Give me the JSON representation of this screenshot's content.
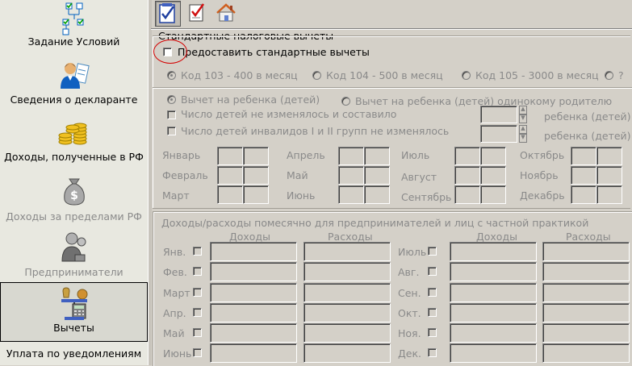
{
  "sidebar": {
    "items": [
      {
        "label": "Задание Условий",
        "icon": "conditions-icon",
        "state": "normal"
      },
      {
        "label": "Сведения о декларанте",
        "icon": "declarant-icon",
        "state": "normal"
      },
      {
        "label": "Доходы, полученные в РФ",
        "icon": "coins-icon",
        "state": "normal"
      },
      {
        "label": "Доходы за пределами РФ",
        "icon": "money-bag-icon",
        "state": "disabled"
      },
      {
        "label": "Предприниматели",
        "icon": "entrepreneur-icon",
        "state": "disabled"
      },
      {
        "label": "Вычеты",
        "icon": "deductions-icon",
        "state": "selected"
      },
      {
        "label": "Уплата по уведомлениям",
        "icon": "",
        "state": "normal"
      }
    ]
  },
  "toolbar": {
    "buttons": [
      {
        "icon": "checklist-icon",
        "active": true
      },
      {
        "icon": "checkmark-doc-icon",
        "active": false
      },
      {
        "icon": "home-icon",
        "active": false
      }
    ]
  },
  "std": {
    "group_title": "Стандартные налоговые вычеты",
    "provide_label": "Предоставить стандартные вычеты",
    "codes": [
      "Код 103 - 400 в месяц",
      "Код 104 - 500 в месяц",
      "Код 105 - 3000 в месяц",
      "?"
    ],
    "child_options": [
      "Вычет на ребенка (детей)",
      "Вычет на ребенка (детей) одинокому родителю"
    ],
    "checks": [
      "Число детей не изменялось и составило",
      "Число детей инвалидов I и II групп не изменялось"
    ],
    "children_suffix": "ребенка (детей)",
    "months": [
      [
        "Январь",
        "Февраль",
        "Март"
      ],
      [
        "Апрель",
        "Май",
        "Июнь"
      ],
      [
        "Июль",
        "Август",
        "Сентябрь"
      ],
      [
        "Октябрь",
        "Ноябрь",
        "Декабрь"
      ]
    ]
  },
  "biz": {
    "group_title": "Доходы/расходы помесячно для предпринимателей и лиц с частной практикой",
    "col_income": "Доходы",
    "col_expense": "Расходы",
    "left_months": [
      "Янв.",
      "Фев.",
      "Март",
      "Апр.",
      "Май",
      "Июнь"
    ],
    "right_months": [
      "Июль",
      "Авг.",
      "Сен.",
      "Окт.",
      "Ноя.",
      "Дек."
    ]
  }
}
